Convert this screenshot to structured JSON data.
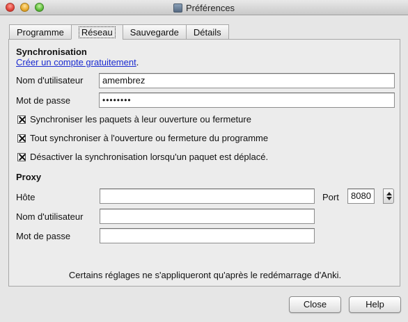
{
  "window": {
    "title": "Préférences"
  },
  "tabs": [
    {
      "label": "Programme"
    },
    {
      "label": "Réseau"
    },
    {
      "label": "Sauvegarde"
    },
    {
      "label": "Détails"
    }
  ],
  "active_tab": "Réseau",
  "sync": {
    "section_title": "Synchronisation",
    "create_account_link": "Créer un compte gratuitement",
    "link_suffix": ".",
    "username_label": "Nom d'utilisateur",
    "username_value": "amembrez",
    "password_label": "Mot de passe",
    "password_value": "••••••••",
    "checkboxes": [
      {
        "label": "Synchroniser les paquets à leur ouverture ou fermeture",
        "checked": true
      },
      {
        "label": "Tout synchroniser à l'ouverture ou fermeture du programme",
        "checked": true
      },
      {
        "label": "Désactiver la synchronisation lorsqu'un paquet est déplacé.",
        "checked": true
      }
    ]
  },
  "proxy": {
    "section_title": "Proxy",
    "host_label": "Hôte",
    "host_value": "",
    "port_label": "Port",
    "port_value": "8080",
    "username_label": "Nom d'utilisateur",
    "username_value": "",
    "password_label": "Mot de passe",
    "password_value": ""
  },
  "footnote": "Certains réglages ne s'appliqueront qu'après le redémarrage d'Anki.",
  "buttons": {
    "close": "Close",
    "help": "Help"
  },
  "colors": {
    "link": "#1a2ad0",
    "window_bg": "#e6e6e6"
  }
}
